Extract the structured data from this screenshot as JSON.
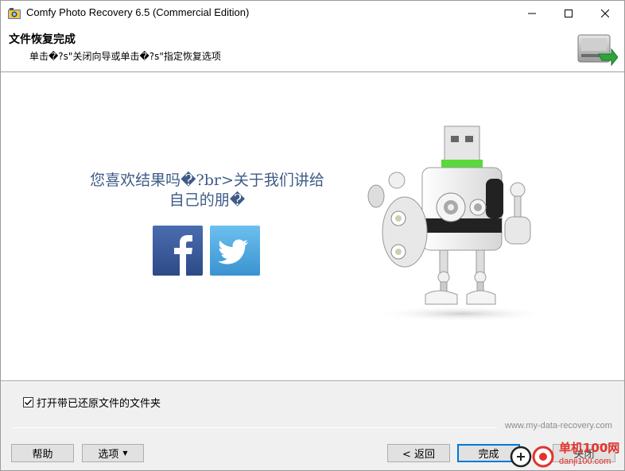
{
  "window": {
    "title": "Comfy Photo Recovery 6.5 (Commercial Edition)",
    "icon": "photo-recovery-app-icon"
  },
  "header": {
    "title": "文件恢复完成",
    "subtitle": "单击�?s\"关闭向导或单击�?s\"指定恢复选项",
    "icon": "hard-drive-recovery-icon"
  },
  "content": {
    "promo_line1": "您喜欢结果吗�?br>关于我们讲给",
    "promo_line2": "自己的朋�",
    "social": {
      "facebook_icon": "facebook-icon",
      "twitter_icon": "twitter-icon",
      "facebook_color": "#3b5998",
      "twitter_color": "#4ea6dd"
    },
    "illustration": "robot-usb-illustration"
  },
  "footer": {
    "checkbox_label": "打开带已还原文件的文件夹",
    "checkbox_checked": true,
    "site_link": "www.my-data-recovery.com",
    "buttons": {
      "help": "帮助",
      "options": "选项",
      "back": "< 返回",
      "finish": "完成",
      "close": "关闭"
    }
  },
  "watermark": {
    "line1": "单机100网",
    "line2": "danji100.com"
  },
  "colors": {
    "accent": "#0078d7",
    "promo_text": "#3e5b88",
    "watermark": "#e3332b"
  }
}
